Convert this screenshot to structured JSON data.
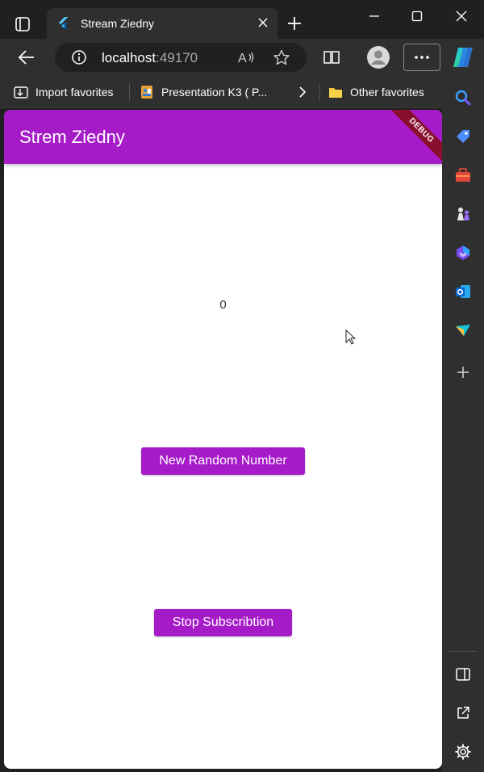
{
  "tab": {
    "title": "Stream Ziedny"
  },
  "address": {
    "host": "localhost",
    "port": ":49170"
  },
  "favorites": [
    {
      "label": "Import favorites",
      "icon": "import-icon"
    },
    {
      "label": "Presentation K3 ( P...",
      "icon": "presentation-icon"
    },
    {
      "label": "Other favorites",
      "icon": "folder-icon"
    }
  ],
  "app": {
    "title": "Strem Ziedny",
    "debug_label": "DEBUG",
    "counter": "0",
    "random_button": "New Random Number",
    "stop_button": "Stop Subscribtion",
    "accent": "#a51bc8"
  },
  "sidebar": [
    "search-icon",
    "tag-icon",
    "toolbox-icon",
    "chess-icon",
    "m365-icon",
    "outlook-icon",
    "send-icon",
    "add-icon",
    "panel-icon",
    "external-icon",
    "settings-icon"
  ]
}
